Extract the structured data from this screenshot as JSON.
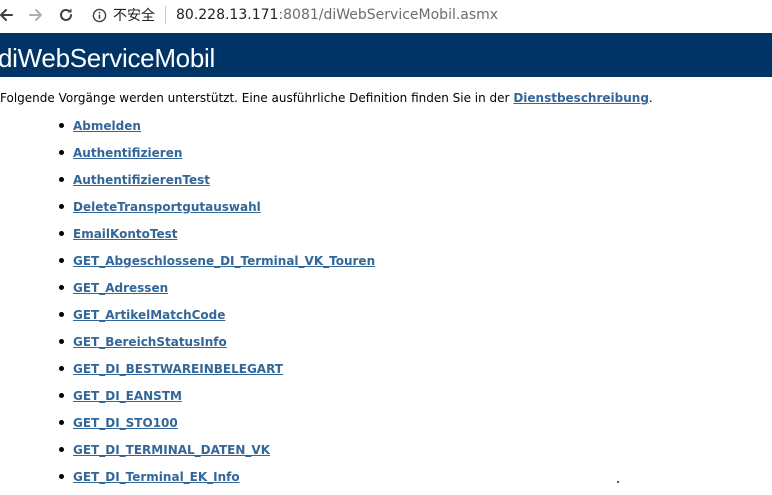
{
  "browser": {
    "security_label": "不安全",
    "url_host": "80.228.13.171",
    "url_rest": ":8081/diWebServiceMobil.asmx"
  },
  "page": {
    "title": "diWebServiceMobil",
    "intro_text": "Folgende Vorgänge werden unterstützt. Eine ausführliche Definition finden Sie in der ",
    "intro_link": "Dienstbeschreibung",
    "intro_end": "."
  },
  "operations": [
    "Abmelden",
    "Authentifizieren",
    "AuthentifizierenTest",
    "DeleteTransportgutauswahl",
    "EmailKontoTest",
    "GET_Abgeschlossene_DI_Terminal_VK_Touren",
    "GET_Adressen",
    "GET_ArtikelMatchCode",
    "GET_BereichStatusInfo",
    "GET_DI_BESTWAREINBELEGART",
    "GET_DI_EANSTM",
    "GET_DI_STO100",
    "GET_DI_TERMINAL_DATEN_VK",
    "GET_DI_Terminal_EK_Info"
  ],
  "colors": {
    "header_bg": "#003366",
    "link": "#336699"
  }
}
